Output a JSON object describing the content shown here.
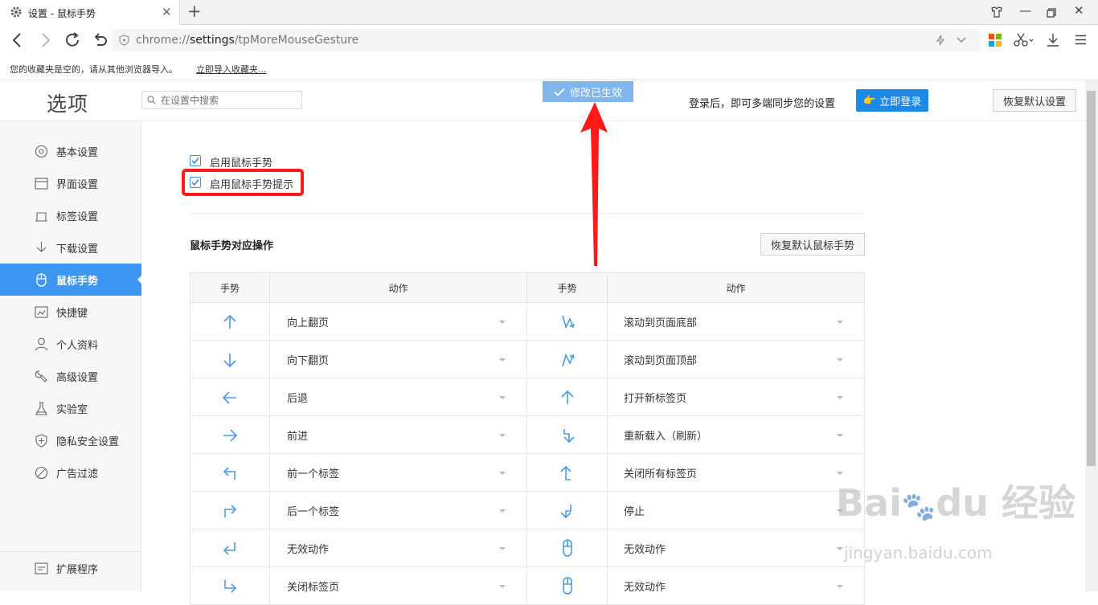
{
  "browser": {
    "tab_title": "设置 - 鼠标手势",
    "new_tab": "+",
    "url_prefix": "chrome://",
    "url_bold": "settings",
    "url_rest": "/tpMoreMouseGesture",
    "bookmark_notice": "您的收藏夹是空的，请从其他浏览器导入。",
    "bookmark_import_link": "立即导入收藏夹..."
  },
  "header": {
    "logo": "选项",
    "search_placeholder": "在设置中搜索",
    "toast": "修改已生效",
    "sync_text": "登录后，即可多端同步您的设置",
    "login_button": "立即登录",
    "restore_button": "恢复默认设置"
  },
  "sidebar": {
    "items": [
      {
        "label": "基本设置",
        "icon": "circle-settings-icon"
      },
      {
        "label": "界面设置",
        "icon": "window-icon"
      },
      {
        "label": "标签设置",
        "icon": "tab-icon"
      },
      {
        "label": "下载设置",
        "icon": "download-icon"
      },
      {
        "label": "鼠标手势",
        "icon": "mouse-icon",
        "active": true
      },
      {
        "label": "快捷键",
        "icon": "keyboard-icon"
      },
      {
        "label": "个人资料",
        "icon": "person-icon"
      },
      {
        "label": "高级设置",
        "icon": "wrench-icon"
      },
      {
        "label": "实验室",
        "icon": "flask-icon"
      },
      {
        "label": "隐私安全设置",
        "icon": "shield-icon"
      },
      {
        "label": "广告过滤",
        "icon": "block-icon"
      }
    ],
    "extensions": "扩展程序"
  },
  "main": {
    "enable_gesture": "启用鼠标手势",
    "enable_gesture_hint": "启用鼠标手势提示",
    "section_title": "鼠标手势对应操作",
    "restore_gestures": "恢复默认鼠标手势",
    "table_headers": [
      "手势",
      "动作",
      "手势",
      "动作"
    ],
    "rows": [
      {
        "left_action": "向上翻页",
        "right_action": "滚动到页面底部"
      },
      {
        "left_action": "向下翻页",
        "right_action": "滚动到页面顶部"
      },
      {
        "left_action": "后退",
        "right_action": "打开新标签页"
      },
      {
        "left_action": "前进",
        "right_action": "重新载入（刷新）"
      },
      {
        "left_action": "前一个标签",
        "right_action": "关闭所有标签页"
      },
      {
        "left_action": "后一个标签",
        "right_action": "停止"
      },
      {
        "left_action": "无效动作",
        "right_action": "无效动作"
      },
      {
        "left_action": "关闭标签页",
        "right_action": "无效动作"
      }
    ]
  },
  "watermark": {
    "brand": "Bai du 经验",
    "url": "jingyan.baidu.com"
  },
  "colors": {
    "accent": "#3d96f2",
    "red_annotation": "#ff1a1a",
    "toast_bg": "#7fb6ec"
  }
}
